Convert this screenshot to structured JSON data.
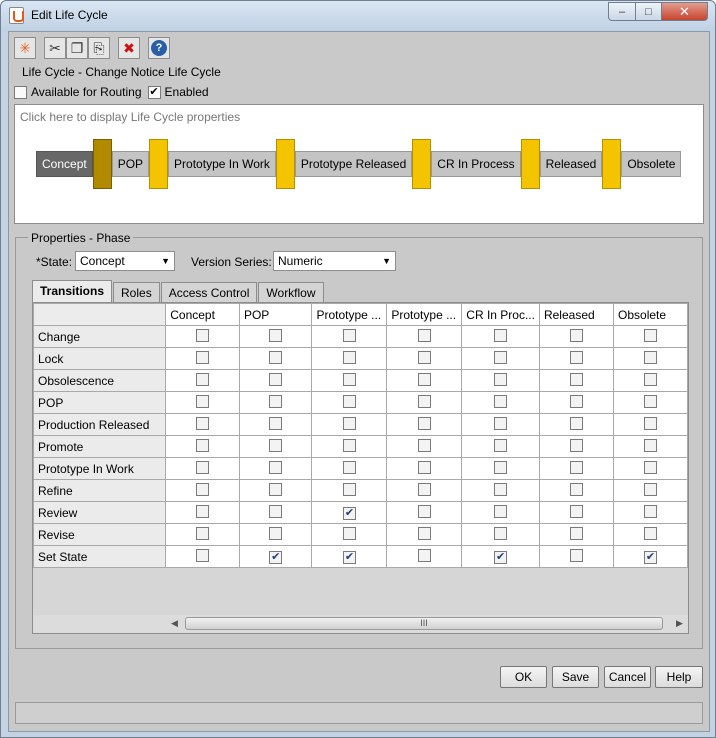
{
  "window": {
    "title": "Edit Life Cycle",
    "min_glyph": "–",
    "max_glyph": "□",
    "close_glyph": "✕"
  },
  "toolbar": {
    "buttons": [
      {
        "icon": "new-icon",
        "glyph": "✳",
        "color": "#e8601c"
      },
      {
        "icon": "cut-icon",
        "glyph": "✂",
        "color": "#333333"
      },
      {
        "icon": "copy-icon",
        "glyph": "❐",
        "color": "#333333"
      },
      {
        "icon": "paste-icon",
        "glyph": "⎘",
        "color": "#333333"
      },
      {
        "icon": "delete-icon",
        "glyph": "✖",
        "color": "#cc1111"
      },
      {
        "icon": "help-icon",
        "glyph": "?",
        "color": "#2a5fa8"
      }
    ]
  },
  "lifecycle_label": "Life Cycle - Change Notice Life Cycle",
  "options": {
    "routing_label": "Available for Routing",
    "routing_checked": false,
    "enabled_label": "Enabled",
    "enabled_checked": true
  },
  "lifecycle_panel": {
    "hint": "Click here to display Life Cycle properties",
    "phases": [
      "Concept",
      "POP",
      "Prototype In Work",
      "Prototype Released",
      "CR In Process",
      "Released",
      "Obsolete"
    ],
    "active_phase": "Concept"
  },
  "properties": {
    "legend": "Properties - Phase",
    "state_label": "*State:",
    "state_value": "Concept",
    "version_label": "Version Series:",
    "version_value": "Numeric"
  },
  "tabs": [
    "Transitions",
    "Roles",
    "Access Control",
    "Workflow"
  ],
  "active_tab": "Transitions",
  "grid": {
    "columns": [
      "Concept",
      "POP",
      "Prototype ...",
      "Prototype ...",
      "CR In Proc...",
      "Released",
      "Obsolete"
    ],
    "rows": [
      {
        "label": "Change",
        "checks": [
          false,
          false,
          false,
          false,
          false,
          false,
          false
        ]
      },
      {
        "label": "Lock",
        "checks": [
          false,
          false,
          false,
          false,
          false,
          false,
          false
        ]
      },
      {
        "label": "Obsolescence",
        "checks": [
          false,
          false,
          false,
          false,
          false,
          false,
          false
        ]
      },
      {
        "label": "POP",
        "checks": [
          false,
          false,
          false,
          false,
          false,
          false,
          false
        ]
      },
      {
        "label": "Production Released",
        "checks": [
          false,
          false,
          false,
          false,
          false,
          false,
          false
        ]
      },
      {
        "label": "Promote",
        "checks": [
          false,
          false,
          false,
          false,
          false,
          false,
          false
        ]
      },
      {
        "label": "Prototype In Work",
        "checks": [
          false,
          false,
          false,
          false,
          false,
          false,
          false
        ]
      },
      {
        "label": "Refine",
        "checks": [
          false,
          false,
          false,
          false,
          false,
          false,
          false
        ]
      },
      {
        "label": "Review",
        "checks": [
          false,
          false,
          true,
          false,
          false,
          false,
          false
        ]
      },
      {
        "label": "Revise",
        "checks": [
          false,
          false,
          false,
          false,
          false,
          false,
          false
        ]
      },
      {
        "label": "Set State",
        "checks": [
          false,
          true,
          true,
          false,
          true,
          false,
          true
        ]
      }
    ],
    "scroll_grip": "III"
  },
  "buttons": {
    "ok": "OK",
    "save": "Save",
    "cancel": "Cancel",
    "help": "Help"
  }
}
